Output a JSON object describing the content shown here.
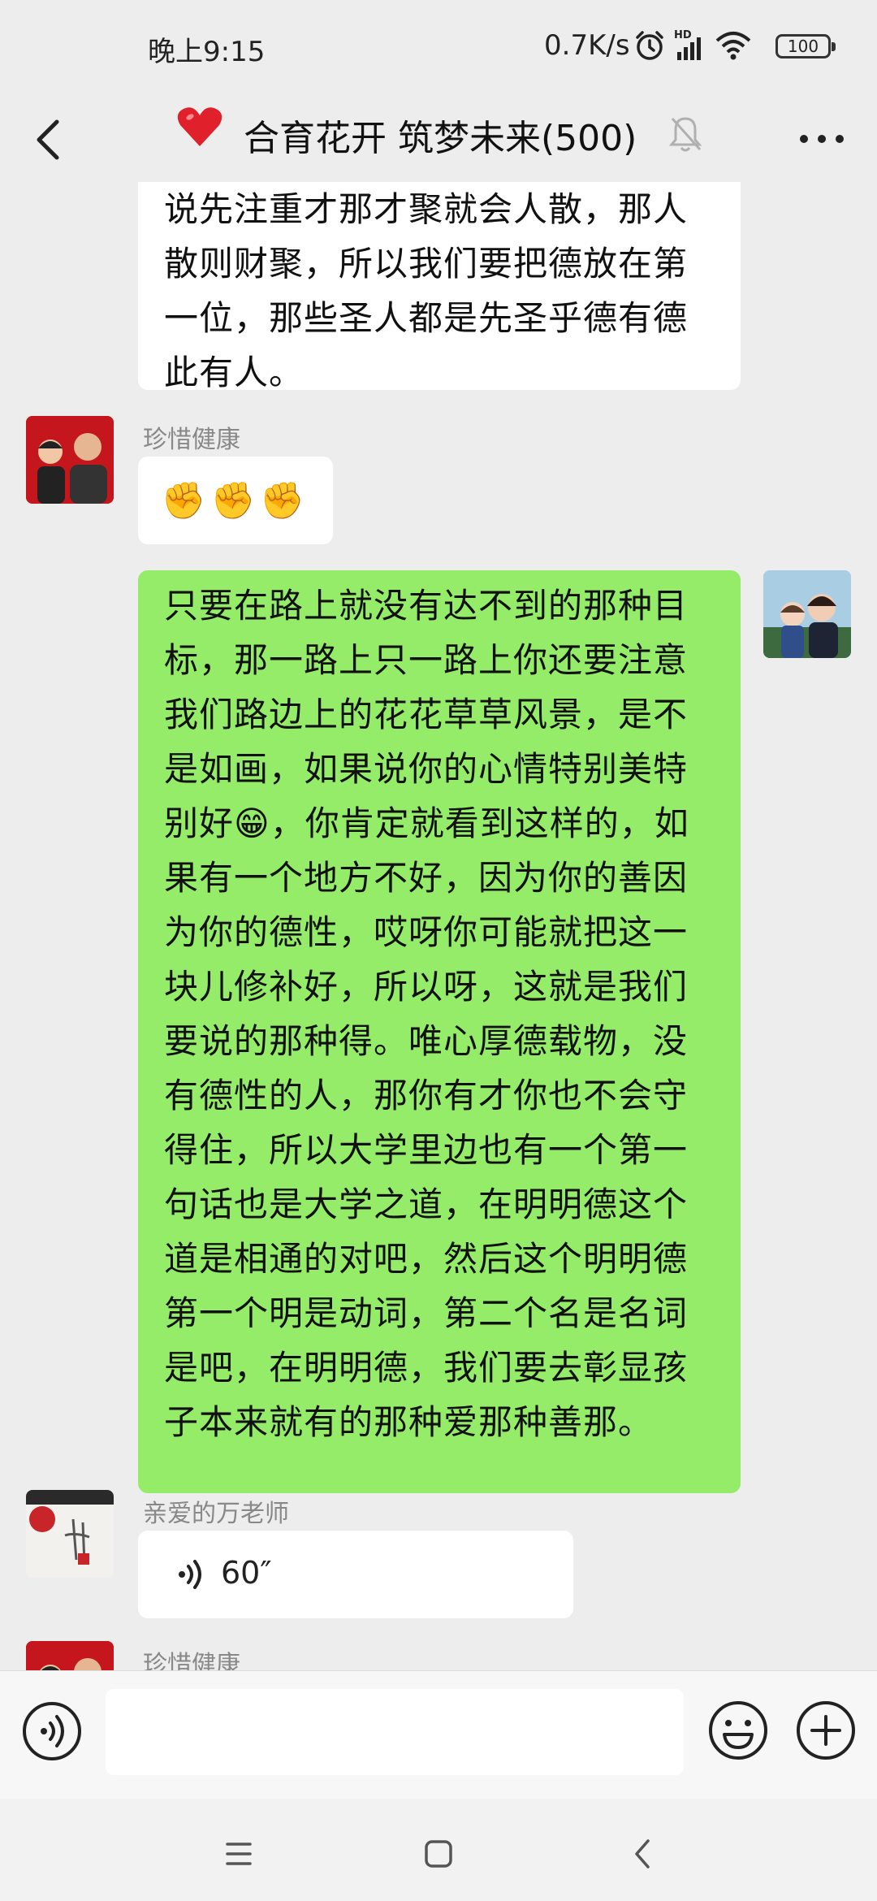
{
  "status_bar": {
    "time": "晚上9:15",
    "network_speed": "0.7K/s",
    "hd_label": "HD",
    "battery": "100",
    "icons": [
      "alarm-icon",
      "signal-icon",
      "wifi-icon",
      "battery-icon"
    ]
  },
  "header": {
    "title": "合育花开 筑梦未来(500)",
    "icons": [
      "back-arrow-icon",
      "heart-icon",
      "muted-bell-icon",
      "more-icon"
    ]
  },
  "messages": [
    {
      "type": "text",
      "side": "left",
      "lines": [
        "说先注重才那才聚就会人散，那人",
        "散则财聚，所以我们要把德放在第",
        "一位，那些圣人都是先圣乎德有德",
        "此有人。"
      ]
    },
    {
      "type": "emoji",
      "side": "left",
      "sender": "珍惜健康",
      "content": "✊✊✊"
    },
    {
      "type": "text",
      "side": "right",
      "lines": [
        "只要在路上就没有达不到的那种目",
        "标，那一路上只一路上你还要注意",
        "我们路边上的花花草草风景，是不",
        "是如画，如果说你的心情特别美特",
        "别好😁，你肯定就看到这样的，如",
        "果有一个地方不好，因为你的善因",
        "为你的德性，哎呀你可能就把这一",
        "块儿修补好，所以呀，这就是我们",
        "要说的那种得。唯心厚德载物，没",
        "有德性的人，那你有才你也不会守",
        "得住，所以大学里边也有一个第一",
        "句话也是大学之道，在明明德这个",
        "道是相通的对吧，然后这个明明德",
        "第一个明是动词，第二个名是名词",
        "是吧，在明明德，我们要去彰显孩",
        "子本来就有的那种爱那种善那。"
      ]
    },
    {
      "type": "voice",
      "side": "left",
      "sender": "亲爱的万老师",
      "duration": "60″"
    },
    {
      "type": "partial",
      "side": "left",
      "sender": "珍惜健康"
    }
  ],
  "input_bar": {
    "placeholder": "",
    "icons": [
      "voice-icon",
      "emoji-icon",
      "plus-icon"
    ]
  },
  "nav_bar": {
    "icons": [
      "menu-icon",
      "home-icon",
      "back-icon"
    ]
  },
  "colors": {
    "background": "#ededed",
    "bubble_self": "#95ec69",
    "bubble_other": "#ffffff",
    "sender_name": "#888888"
  }
}
